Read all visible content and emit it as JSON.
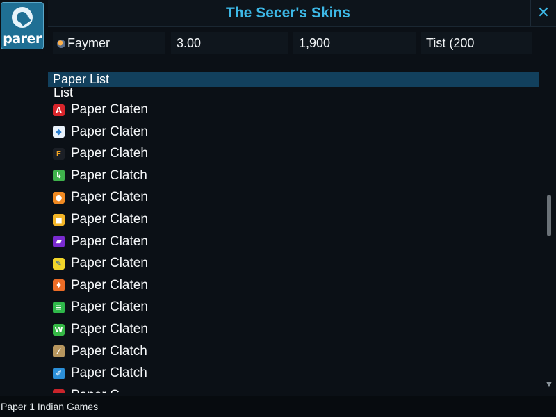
{
  "logo": {
    "text": "parer"
  },
  "header": {
    "title": "The Secer's Skins",
    "close_label": "✕"
  },
  "info_row": {
    "name": "Faymer",
    "value1": "3.00",
    "value2": "1,900",
    "value3": "Tist (200"
  },
  "list": {
    "header": "Paper List",
    "subheader": "List",
    "items": [
      {
        "label": "Paper Claten",
        "icon": "red-a-icon",
        "color": "#d9252b",
        "glyph": "A"
      },
      {
        "label": "Paper Claten",
        "icon": "blue-drop-icon",
        "color": "#e9f2fb",
        "glyph": "◆"
      },
      {
        "label": "Paper Clateh",
        "icon": "orange-f-icon",
        "color": "#1b1f26",
        "glyph": "F"
      },
      {
        "label": "Paper Clatch",
        "icon": "green-phone-icon",
        "color": "#3fb24c",
        "glyph": "↳"
      },
      {
        "label": "Paper Claten",
        "icon": "orange-circle-icon",
        "color": "#f08a22",
        "glyph": "●"
      },
      {
        "label": "Paper Claten",
        "icon": "multicolor-grid-icon",
        "color": "#f3b526",
        "glyph": "■"
      },
      {
        "label": "Paper Claten",
        "icon": "purple-game-icon",
        "color": "#7a2bd0",
        "glyph": "▰"
      },
      {
        "label": "Paper Claten",
        "icon": "yellow-note-icon",
        "color": "#f1d52a",
        "glyph": "✎"
      },
      {
        "label": "Paper Claten",
        "icon": "orange-bell-icon",
        "color": "#ec6c26",
        "glyph": "♦"
      },
      {
        "label": "Paper Claten",
        "icon": "green-text-icon",
        "color": "#2fb84a",
        "glyph": "≡"
      },
      {
        "label": "Paper Claten",
        "icon": "green-w-icon",
        "color": "#35b745",
        "glyph": "W"
      },
      {
        "label": "Paper Clatch",
        "icon": "tan-tool-icon",
        "color": "#b7965e",
        "glyph": "⁄"
      },
      {
        "label": "Paper Clatch",
        "icon": "blue-pen-icon",
        "color": "#2b8fd8",
        "glyph": "✐"
      },
      {
        "label": "Paper C...",
        "icon": "red-partial-icon",
        "color": "#c9242b",
        "glyph": ""
      }
    ]
  },
  "status": {
    "text": "Paper 1 Indian Games"
  }
}
